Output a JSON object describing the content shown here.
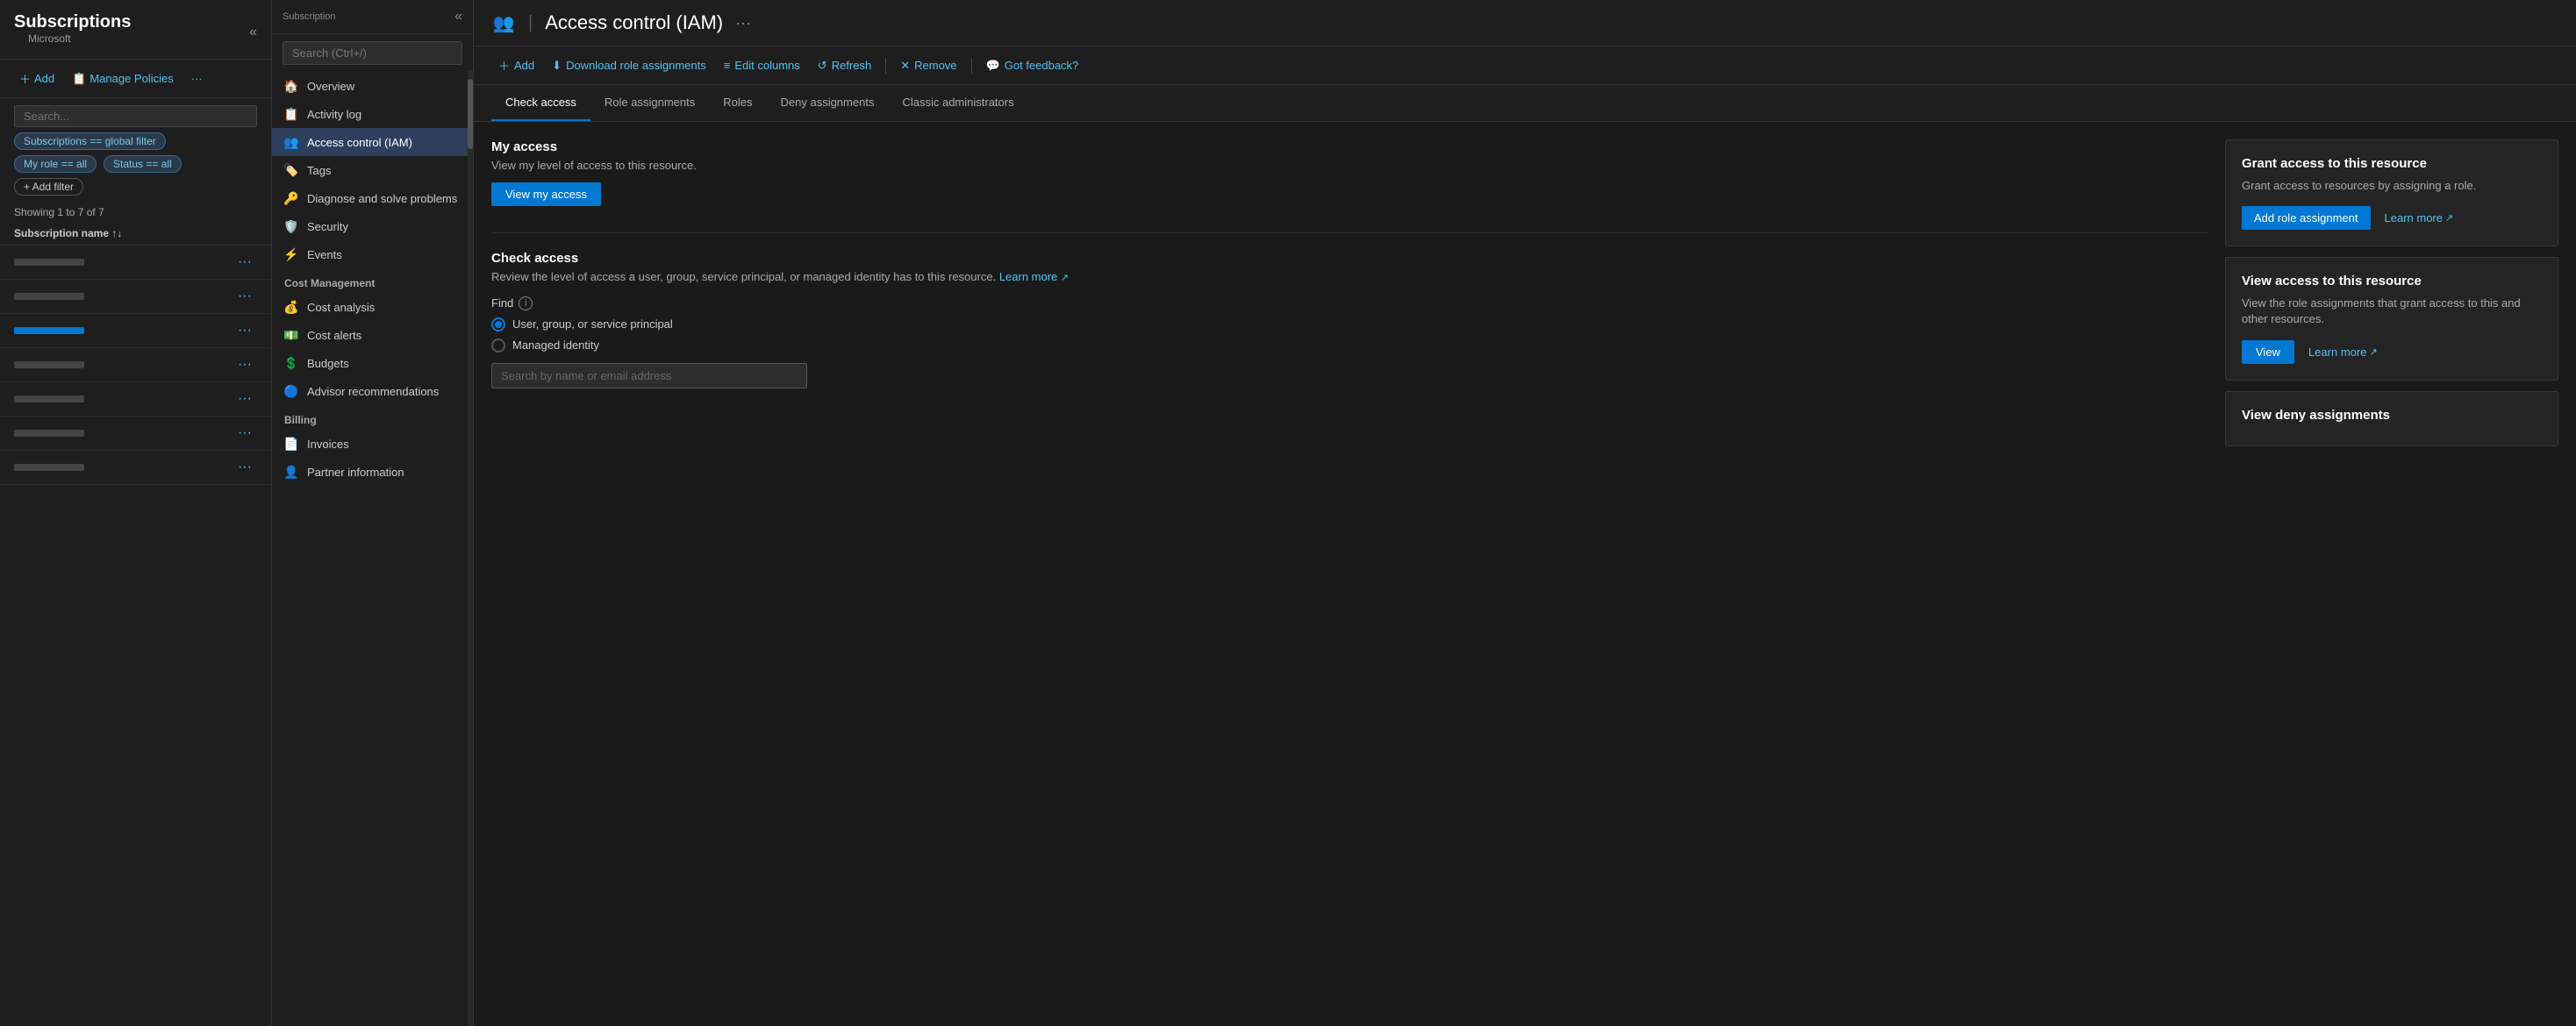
{
  "left_sidebar": {
    "title": "Subscriptions",
    "subtitle": "Microsoft",
    "collapse_label": "«",
    "toolbar": {
      "add_label": "Add",
      "manage_policies_label": "Manage Policies",
      "more_label": "···"
    },
    "filters": {
      "search_placeholder": "Search...",
      "global_filter_chip": "Subscriptions == global filter",
      "my_role_chip": "My role == all",
      "status_chip": "Status == all",
      "add_filter_label": "+ Add filter"
    },
    "showing_text": "Showing 1 to 7 of 7",
    "table_header": "Subscription name ↑↓",
    "rows": [
      {
        "id": 1,
        "has_bar": false
      },
      {
        "id": 2,
        "has_bar": false
      },
      {
        "id": 3,
        "has_bar": true,
        "selected": true
      },
      {
        "id": 4,
        "has_bar": false
      },
      {
        "id": 5,
        "has_bar": false
      },
      {
        "id": 6,
        "has_bar": false
      },
      {
        "id": 7,
        "has_bar": false
      }
    ]
  },
  "middle_sidebar": {
    "subscription_label": "Subscription",
    "search_placeholder": "Search (Ctrl+/)",
    "nav_items": [
      {
        "id": "overview",
        "label": "Overview",
        "icon": "🏠",
        "active": false
      },
      {
        "id": "activity-log",
        "label": "Activity log",
        "icon": "📋",
        "active": false
      },
      {
        "id": "access-control",
        "label": "Access control (IAM)",
        "icon": "👥",
        "active": true
      },
      {
        "id": "tags",
        "label": "Tags",
        "icon": "🏷️",
        "active": false
      },
      {
        "id": "diagnose",
        "label": "Diagnose and solve problems",
        "icon": "🔑",
        "active": false
      },
      {
        "id": "security",
        "label": "Security",
        "icon": "🛡️",
        "active": false
      },
      {
        "id": "events",
        "label": "Events",
        "icon": "⚡",
        "active": false
      }
    ],
    "sections": [
      {
        "label": "Cost Management",
        "items": [
          {
            "id": "cost-analysis",
            "label": "Cost analysis",
            "icon": "💰",
            "active": false
          },
          {
            "id": "cost-alerts",
            "label": "Cost alerts",
            "icon": "💵",
            "active": false
          },
          {
            "id": "budgets",
            "label": "Budgets",
            "icon": "💲",
            "active": false
          },
          {
            "id": "advisor",
            "label": "Advisor recommendations",
            "icon": "🔵",
            "active": false
          }
        ]
      },
      {
        "label": "Billing",
        "items": [
          {
            "id": "invoices",
            "label": "Invoices",
            "icon": "📄",
            "active": false
          },
          {
            "id": "partner",
            "label": "Partner information",
            "icon": "👤",
            "active": false
          }
        ]
      }
    ]
  },
  "main_header": {
    "title": "Access control (IAM)",
    "icon": "👥",
    "more_label": "···"
  },
  "main_toolbar": {
    "add_label": "Add",
    "download_label": "Download role assignments",
    "edit_columns_label": "Edit columns",
    "refresh_label": "Refresh",
    "remove_label": "Remove",
    "feedback_label": "Got feedback?"
  },
  "tabs": [
    {
      "id": "check-access",
      "label": "Check access",
      "active": true
    },
    {
      "id": "role-assignments",
      "label": "Role assignments",
      "active": false
    },
    {
      "id": "roles",
      "label": "Roles",
      "active": false
    },
    {
      "id": "deny-assignments",
      "label": "Deny assignments",
      "active": false
    },
    {
      "id": "classic-admins",
      "label": "Classic administrators",
      "active": false
    }
  ],
  "check_access": {
    "my_access": {
      "title": "My access",
      "description": "View my level of access to this resource.",
      "button_label": "View my access"
    },
    "check_access": {
      "title": "Check access",
      "description": "Review the level of access a user, group, service principal, or managed identity has to this resource.",
      "learn_more_label": "Learn more",
      "find_label": "Find",
      "radio_options": [
        {
          "id": "user-group",
          "label": "User, group, or service principal",
          "selected": true
        },
        {
          "id": "managed-identity",
          "label": "Managed identity",
          "selected": false
        }
      ],
      "search_placeholder": "Search by name or email address"
    }
  },
  "right_panel": {
    "grant_access": {
      "title": "Grant access to this resource",
      "description": "Grant access to resources by assigning a role.",
      "add_role_label": "Add role assignment",
      "learn_more_label": "Learn more"
    },
    "view_access": {
      "title": "View access to this resource",
      "description": "View the role assignments that grant access to this and other resources.",
      "view_label": "View",
      "learn_more_label": "Learn more"
    },
    "view_deny": {
      "title": "View deny assignments"
    }
  }
}
